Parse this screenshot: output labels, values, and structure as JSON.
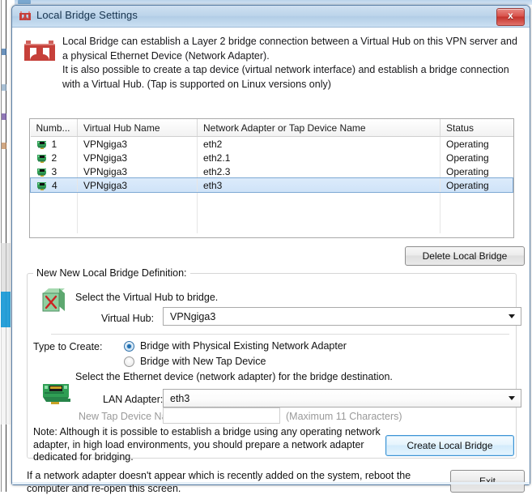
{
  "window": {
    "title": "Local Bridge Settings",
    "title_icon": "bridge-icon",
    "close_label": "x"
  },
  "header": {
    "icon": "bridge-icon",
    "description": "Local Bridge can establish a Layer 2 bridge connection between a Virtual Hub on this VPN server and a physical Ethernet Device (Network Adapter).\nIt is also possible to create a tap device (virtual network interface) and establish a bridge connection with a Virtual Hub. (Tap is supported on Linux versions only)"
  },
  "table": {
    "columns": [
      "Numb...",
      "Virtual Hub Name",
      "Network Adapter or Tap Device Name",
      "Status"
    ],
    "rows": [
      {
        "number": "1",
        "hub": "VPNgiga3",
        "adapter": "eth2",
        "status": "Operating",
        "selected": false
      },
      {
        "number": "2",
        "hub": "VPNgiga3",
        "adapter": "eth2.1",
        "status": "Operating",
        "selected": false
      },
      {
        "number": "3",
        "hub": "VPNgiga3",
        "adapter": "eth2.3",
        "status": "Operating",
        "selected": false
      },
      {
        "number": "4",
        "hub": "VPNgiga3",
        "adapter": "eth3",
        "status": "Operating",
        "selected": true
      }
    ],
    "empty_rows": 3
  },
  "buttons": {
    "delete_local_bridge": "Delete Local Bridge",
    "create_local_bridge": "Create Local Bridge",
    "exit": "Exit"
  },
  "group": {
    "legend": "New New Local Bridge Definition:",
    "hub_icon": "virtual-hub-icon",
    "select_hub_label": "Select the Virtual Hub to bridge.",
    "virtual_hub_label": "Virtual Hub:",
    "virtual_hub_value": "VPNgiga3",
    "type_to_create_label": "Type to Create:",
    "radio_physical_label": "Bridge with Physical Existing Network Adapter",
    "radio_tap_label": "Bridge with New Tap Device",
    "radio_selected": "physical",
    "nic_icon": "network-adapter-icon",
    "select_ethernet_label": "Select the Ethernet device (network adapter) for the bridge destination.",
    "lan_adapter_label": "LAN Adapter:",
    "lan_adapter_value": "eth3",
    "tap_name_label": "New Tap Device Name:",
    "tap_name_value": "",
    "tap_name_hint": "(Maximum 11 Characters)",
    "note": "Note: Although it is possible to establish a bridge using any operating network adapter, in high load environments, you should prepare a network adapter dedicated for bridging."
  },
  "footer": {
    "text": "If a network adapter doesn't appear which is recently added on the system, reboot the computer and re-open this screen."
  },
  "colors": {
    "titlebar": "#bcd4ea",
    "close_red": "#d9534c",
    "selection_blue": "#cfe3f8",
    "focus_blue": "#3c93d4",
    "nic_green": "#2f9e54",
    "bridge_red": "#c6403a"
  }
}
